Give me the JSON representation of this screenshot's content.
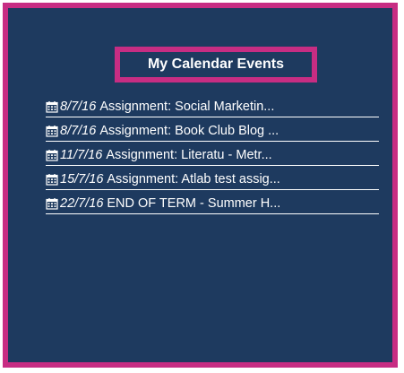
{
  "widget": {
    "title": "My Calendar Events",
    "events": [
      {
        "date": "8/7/16",
        "title": "Assignment: Social Marketin..."
      },
      {
        "date": "8/7/16",
        "title": "Assignment: Book Club Blog ..."
      },
      {
        "date": "11/7/16",
        "title": "Assignment: Literatu - Metr..."
      },
      {
        "date": "15/7/16",
        "title": "Assignment: Atlab test assig..."
      },
      {
        "date": "22/7/16",
        "title": "END OF TERM - Summer H..."
      }
    ]
  },
  "icons": {
    "event": "calendar-icon"
  },
  "colors": {
    "background": "#1e3a5f",
    "highlight_border": "#c72d83",
    "text": "#ffffff"
  }
}
